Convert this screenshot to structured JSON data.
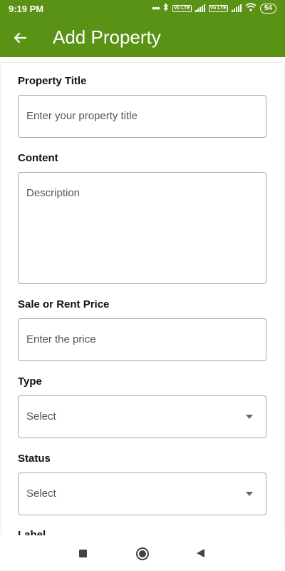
{
  "status_bar": {
    "time": "9:19 PM",
    "battery": "54",
    "volte_1": "Vo LTE",
    "volte_2": "Vo LTE",
    "icons": [
      "more-dots-icon",
      "bluetooth-icon",
      "signal-icon",
      "signal-icon",
      "wifi-icon",
      "battery-icon"
    ]
  },
  "app_bar": {
    "title": "Add Property",
    "back_icon": "arrow-left-icon",
    "color": "#5a9215"
  },
  "form": {
    "property_title": {
      "label": "Property Title",
      "placeholder": "Enter your property title"
    },
    "content": {
      "label": "Content",
      "placeholder": "Description"
    },
    "price": {
      "label": "Sale or Rent Price",
      "placeholder": "Enter the price"
    },
    "type": {
      "label": "Type",
      "value": "Select"
    },
    "status": {
      "label": "Status",
      "value": "Select"
    },
    "label_field": {
      "label": "Label"
    }
  },
  "nav_bar": {
    "icons": [
      "recents-square-icon",
      "home-circle-icon",
      "back-triangle-icon"
    ]
  }
}
